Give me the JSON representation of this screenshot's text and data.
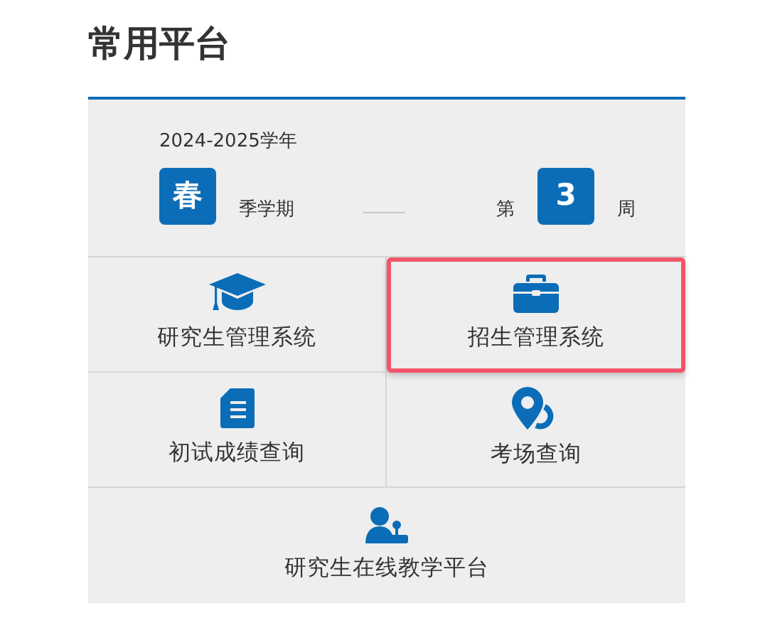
{
  "title": "常用平台",
  "term": {
    "year": "2024-2025学年",
    "season": "春",
    "season_suffix": "季学期",
    "week_prefix": "第",
    "week": "3",
    "week_suffix": "周"
  },
  "platforms": [
    {
      "label": "研究生管理系统",
      "kind": "graduate",
      "selected": false
    },
    {
      "label": "招生管理系统",
      "kind": "briefcase",
      "selected": true
    },
    {
      "label": "初试成绩查询",
      "kind": "document",
      "selected": false
    },
    {
      "label": "考场查询",
      "kind": "location",
      "selected": false
    },
    {
      "label": "研究生在线教学平台",
      "kind": "teacher",
      "selected": false
    }
  ]
}
